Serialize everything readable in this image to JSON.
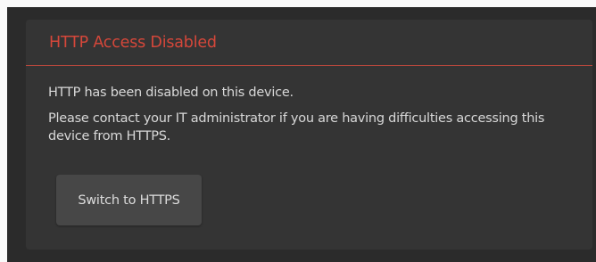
{
  "dialog": {
    "title": "HTTP Access Disabled",
    "message_1": "HTTP has been disabled on this device.",
    "message_2": "Please contact your IT administrator if you are having difficulties accessing this device from HTTPS.",
    "button_label": "Switch to HTTPS"
  },
  "colors": {
    "title": "#d5473a",
    "divider": "#b5473c",
    "panel_bg": "#343434",
    "backdrop_bg": "#2b2b2b",
    "button_bg": "#474747",
    "text": "#d8d8d8"
  }
}
